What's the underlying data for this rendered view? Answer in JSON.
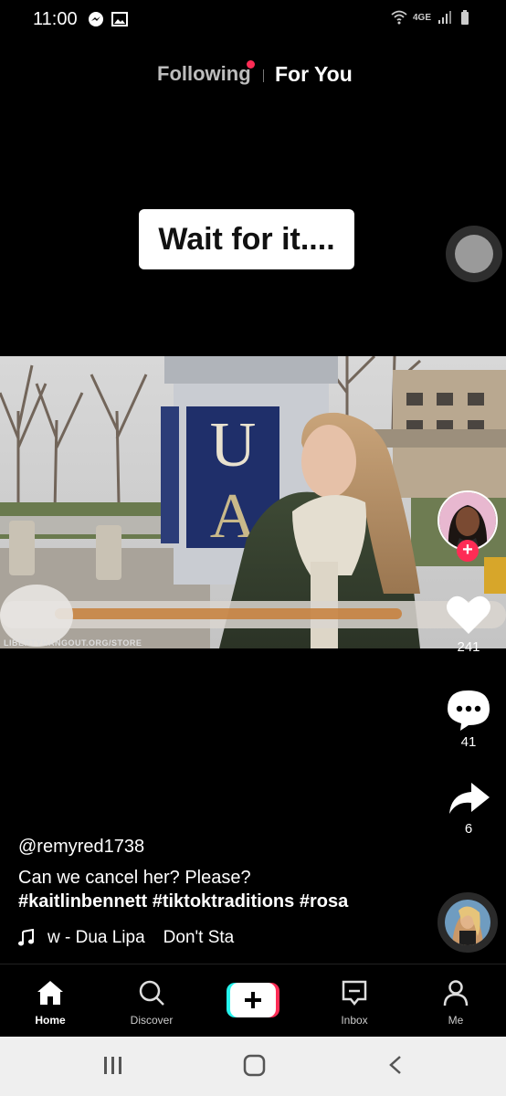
{
  "status_bar": {
    "time": "11:00",
    "network": "4GE",
    "icons": [
      "messenger-icon",
      "gallery-icon",
      "wifi-icon",
      "signal-icon",
      "battery-icon"
    ]
  },
  "top_tabs": {
    "following": "Following",
    "for_you": "For You",
    "active": "For You",
    "notification_dot_color": "#fe2c55"
  },
  "overlay_caption": "Wait for it....",
  "video": {
    "watermark": "LIBERTYHANGOUT.ORG/STORE",
    "sign_letters": [
      "U",
      "A"
    ]
  },
  "actions": {
    "likes": "241",
    "comments": "41",
    "shares": "6"
  },
  "post": {
    "username": "@remyred1738",
    "description": "Can we cancel her? Please?",
    "hashtags": "#kaitlinbennett #tiktoktraditions #rosa",
    "music_part1": "w - Dua Lipa",
    "music_part2": "Don't Sta"
  },
  "bottom_nav": {
    "home": "Home",
    "discover": "Discover",
    "inbox": "Inbox",
    "me": "Me",
    "create_symbol": "+"
  },
  "colors": {
    "accent_red": "#fe2c55",
    "accent_cyan": "#25f4ee"
  }
}
